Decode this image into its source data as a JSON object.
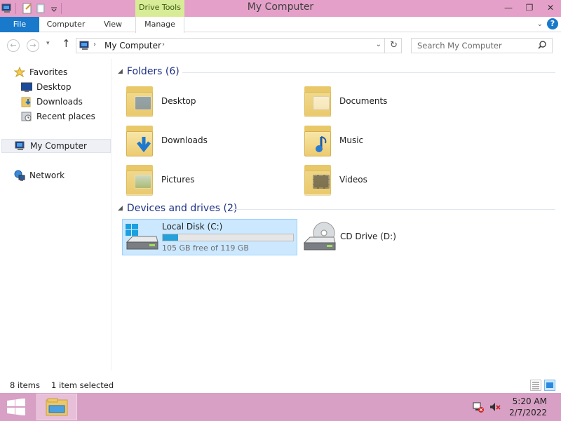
{
  "window": {
    "title": "My Computer",
    "contextual_tab_group": "Drive Tools",
    "controls": {
      "minimize": "—",
      "maximize": "❐",
      "close": "✕"
    }
  },
  "ribbon": {
    "tabs": [
      "File",
      "Computer",
      "View",
      "Manage"
    ],
    "collapse_icon": "chevron-down-icon",
    "help_label": "?"
  },
  "address_bar": {
    "path": "My Computer",
    "search_placeholder": "Search My Computer"
  },
  "navigation": {
    "favorites_label": "Favorites",
    "favorites": [
      "Desktop",
      "Downloads",
      "Recent places"
    ],
    "computer_label": "My Computer",
    "network_label": "Network"
  },
  "content": {
    "folders_header": "Folders (6)",
    "folders": [
      {
        "name": "Desktop",
        "icon": "desktop-folder-icon"
      },
      {
        "name": "Documents",
        "icon": "documents-folder-icon"
      },
      {
        "name": "Downloads",
        "icon": "downloads-folder-icon"
      },
      {
        "name": "Music",
        "icon": "music-folder-icon"
      },
      {
        "name": "Pictures",
        "icon": "pictures-folder-icon"
      },
      {
        "name": "Videos",
        "icon": "videos-folder-icon"
      }
    ],
    "devices_header": "Devices and drives (2)",
    "drives": {
      "local": {
        "name": "Local Disk (C:)",
        "free_text": "105 GB free of 119 GB",
        "used_fraction": 0.118
      },
      "cd": {
        "name": "CD Drive (D:)"
      }
    }
  },
  "status": {
    "item_count": "8 items",
    "selection": "1 item selected"
  },
  "taskbar": {
    "time": "5:20 AM",
    "date": "2/7/2022"
  },
  "colors": {
    "titlebar": "#e4a0c8",
    "taskbar": "#d7a0c4",
    "file_tab": "#1979ca",
    "drive_tools": "#d8ec98",
    "selection": "#cce8ff",
    "group_header": "#1e3287"
  }
}
